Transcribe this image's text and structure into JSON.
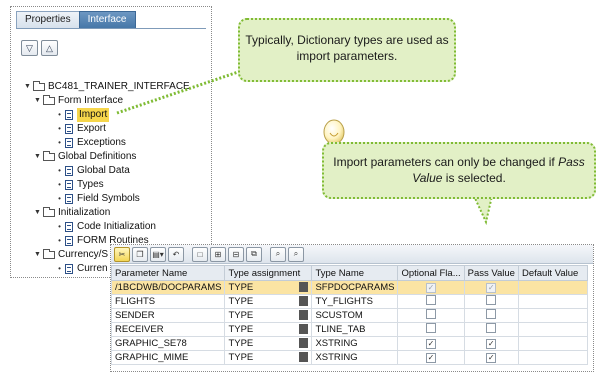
{
  "tabs": [
    {
      "label": "Properties",
      "active": false
    },
    {
      "label": "Interface",
      "active": true
    }
  ],
  "tree": {
    "root": "BC481_TRAINER_INTERFACE",
    "form_interface": {
      "label": "Form Interface",
      "items": [
        "Import",
        "Export",
        "Exceptions"
      ],
      "selected": "Import"
    },
    "global_definitions": {
      "label": "Global Definitions",
      "items": [
        "Global Data",
        "Types",
        "Field Symbols"
      ]
    },
    "initialization": {
      "label": "Initialization",
      "items": [
        "Code Initialization",
        "FORM Routines"
      ]
    },
    "currency": {
      "label": "Currency/S",
      "items": [
        "Curren"
      ]
    }
  },
  "callouts": {
    "dictionary_types": "Typically, Dictionary types are used as import parameters.",
    "pass_value_prefix": "Import parameters can only be changed if",
    "pass_value_em": "Pass Value",
    "pass_value_suffix": "is selected."
  },
  "params_table": {
    "headers": [
      "Parameter Name",
      "Type assignment",
      "Type Name",
      "Optional Fla...",
      "Pass Value",
      "Default Value"
    ],
    "rows": [
      {
        "name": "/1BCDWB/DOCPARAMS",
        "assignment": "TYPE",
        "type_name": "SFPDOCPARAMS",
        "optional": true,
        "pass_value": true,
        "default": "",
        "disabled": true
      },
      {
        "name": "FLIGHTS",
        "assignment": "TYPE",
        "type_name": "TY_FLIGHTS",
        "optional": false,
        "pass_value": false,
        "default": "",
        "disabled": false
      },
      {
        "name": "SENDER",
        "assignment": "TYPE",
        "type_name": "SCUSTOM",
        "optional": false,
        "pass_value": false,
        "default": "",
        "disabled": false
      },
      {
        "name": "RECEIVER",
        "assignment": "TYPE",
        "type_name": "TLINE_TAB",
        "optional": false,
        "pass_value": false,
        "default": "",
        "disabled": false
      },
      {
        "name": "GRAPHIC_SE78",
        "assignment": "TYPE",
        "type_name": "XSTRING",
        "optional": true,
        "pass_value": true,
        "default": "",
        "disabled": false
      },
      {
        "name": "GRAPHIC_MIME",
        "assignment": "TYPE",
        "type_name": "XSTRING",
        "optional": true,
        "pass_value": true,
        "default": "",
        "disabled": false
      }
    ]
  },
  "colors": {
    "callout_fill": "#e2f0c6",
    "callout_border": "#7fbb34",
    "selection": "#f6d64b",
    "tab_active": "#4677a8"
  }
}
